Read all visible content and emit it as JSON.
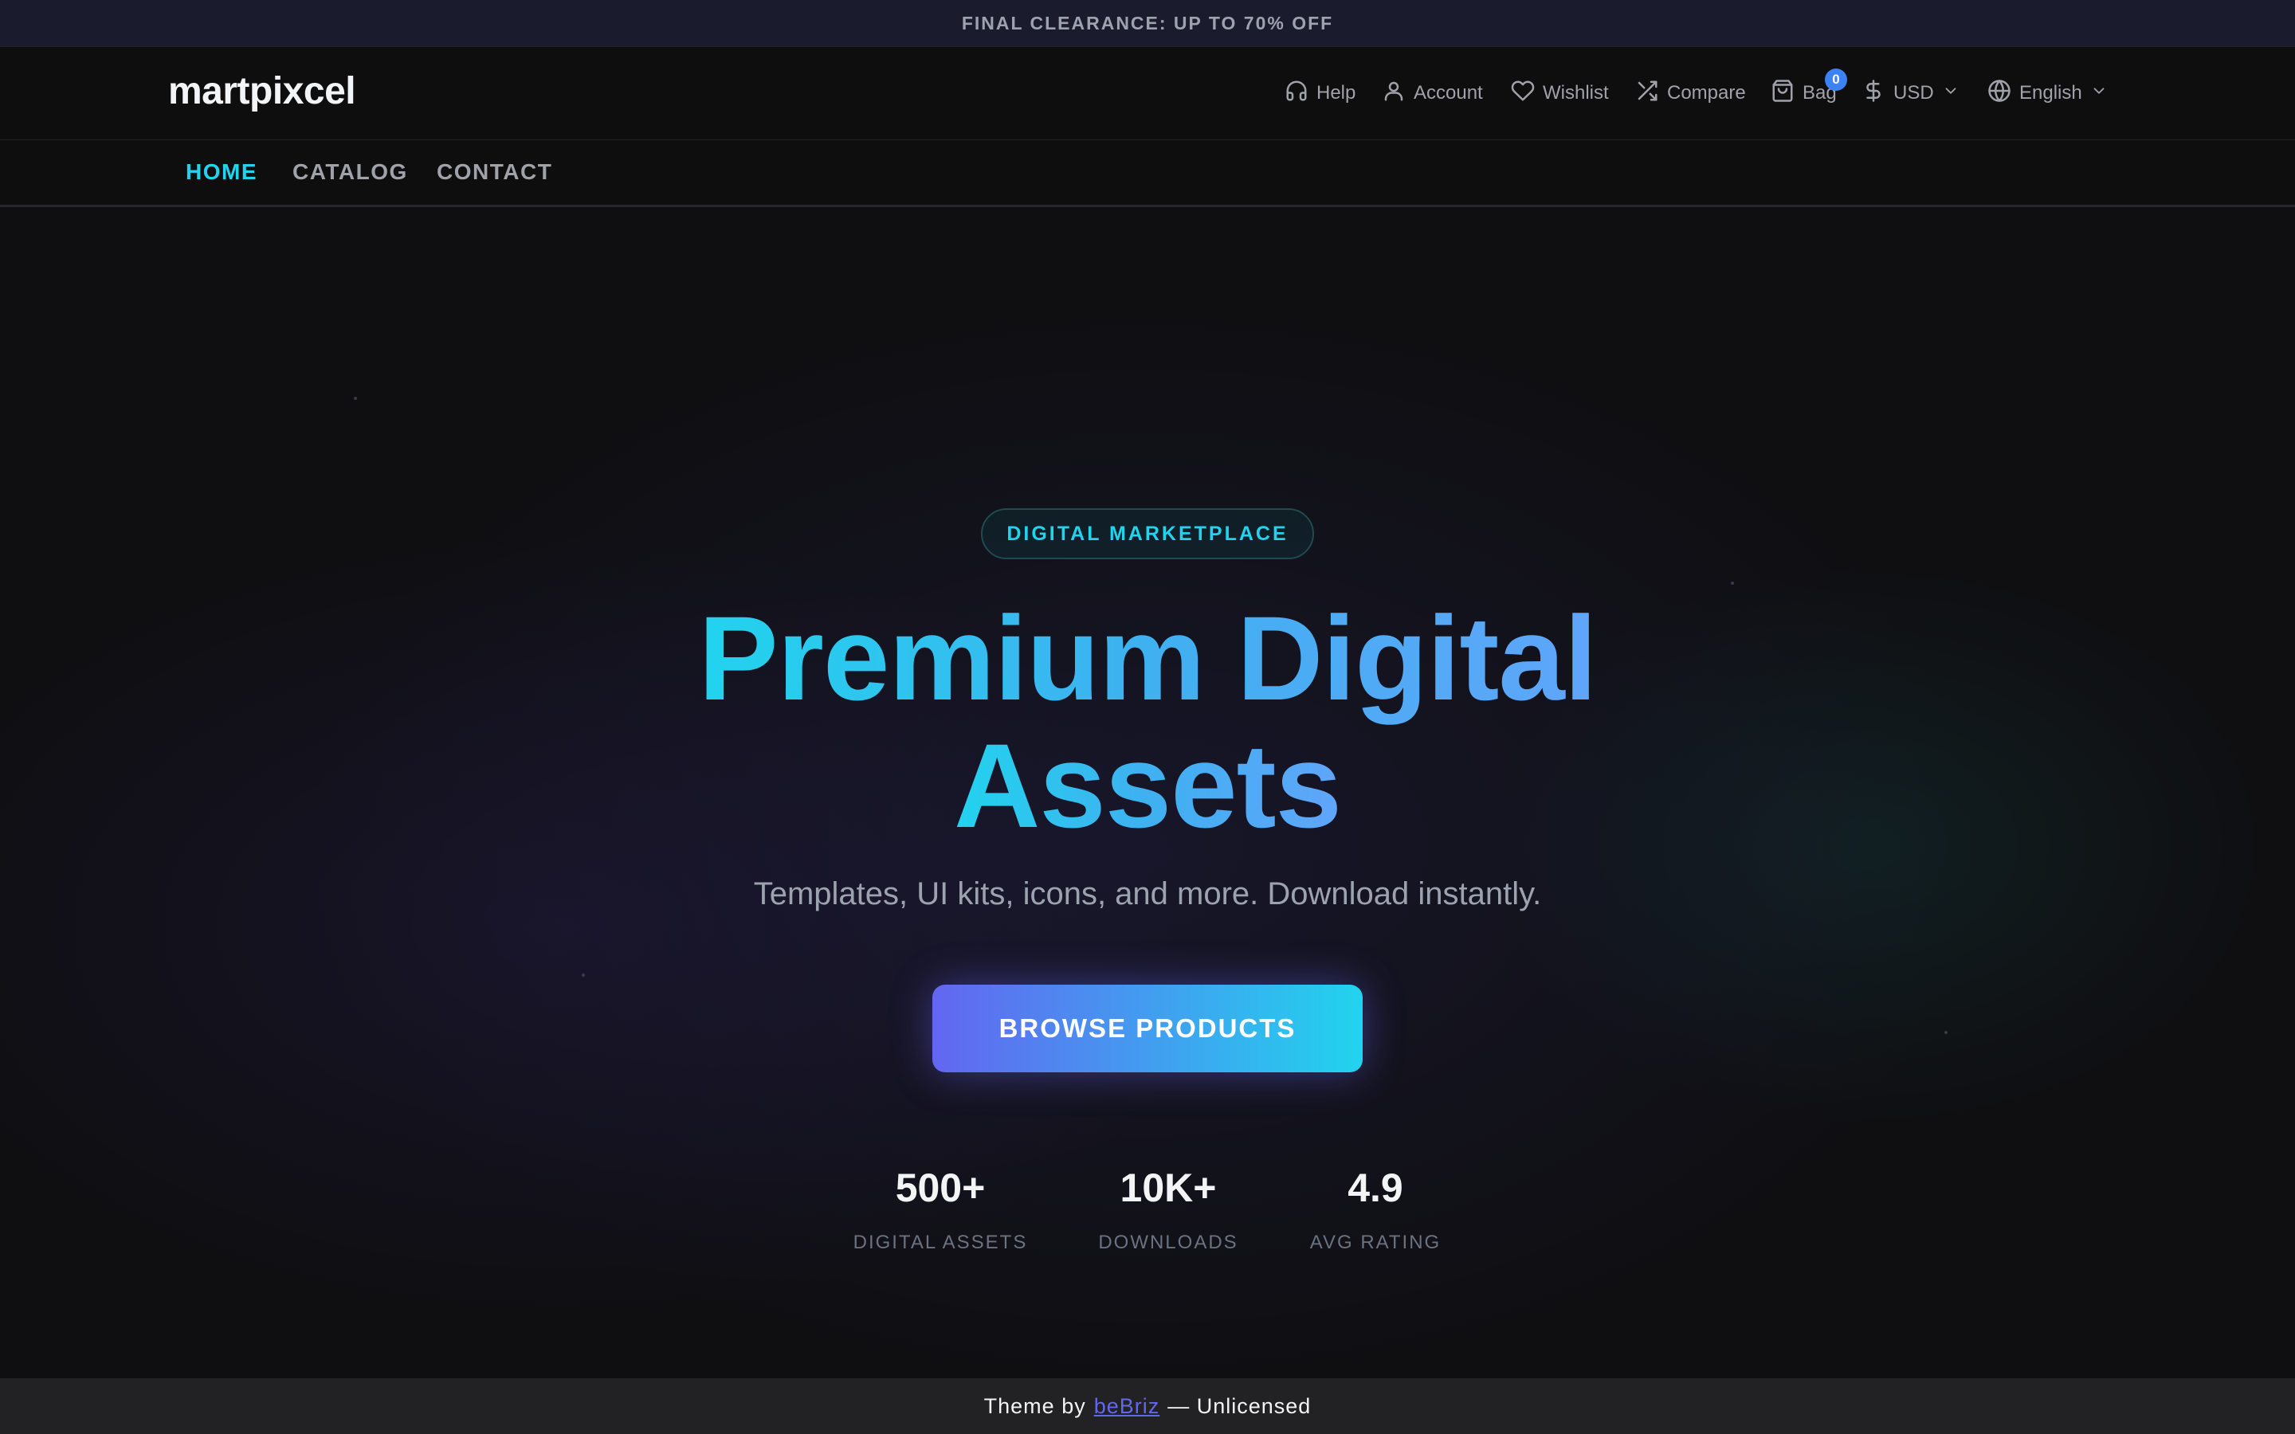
{
  "promo": {
    "text": "FINAL CLEARANCE: UP TO 70% OFF"
  },
  "header": {
    "logo": "martpixcel",
    "help": "Help",
    "account": "Account",
    "wishlist": "Wishlist",
    "compare": "Compare",
    "bag": "Bag",
    "bag_count": "0",
    "currency": "USD",
    "language": "English"
  },
  "nav": {
    "items": [
      {
        "label": "HOME",
        "active": true
      },
      {
        "label": "CATALOG",
        "active": false
      },
      {
        "label": "CONTACT",
        "active": false
      }
    ]
  },
  "hero": {
    "pill": "DIGITAL MARKETPLACE",
    "headline_line1": "Premium Digital",
    "headline_line2": "Assets",
    "subtitle": "Templates, UI kits, icons, and more. Download instantly.",
    "cta": "BROWSE PRODUCTS",
    "stats": [
      {
        "value": "500+",
        "label": "DIGITAL ASSETS"
      },
      {
        "value": "10K+",
        "label": "DOWNLOADS"
      },
      {
        "value": "4.9",
        "label": "AVG RATING"
      }
    ]
  },
  "footer": {
    "prefix": "Theme by",
    "link": "beBriz",
    "suffix": "— Unlicensed"
  },
  "colors": {
    "accent_cyan": "#22d3ee",
    "accent_indigo": "#6366f1",
    "badge_blue": "#3b82f6"
  }
}
